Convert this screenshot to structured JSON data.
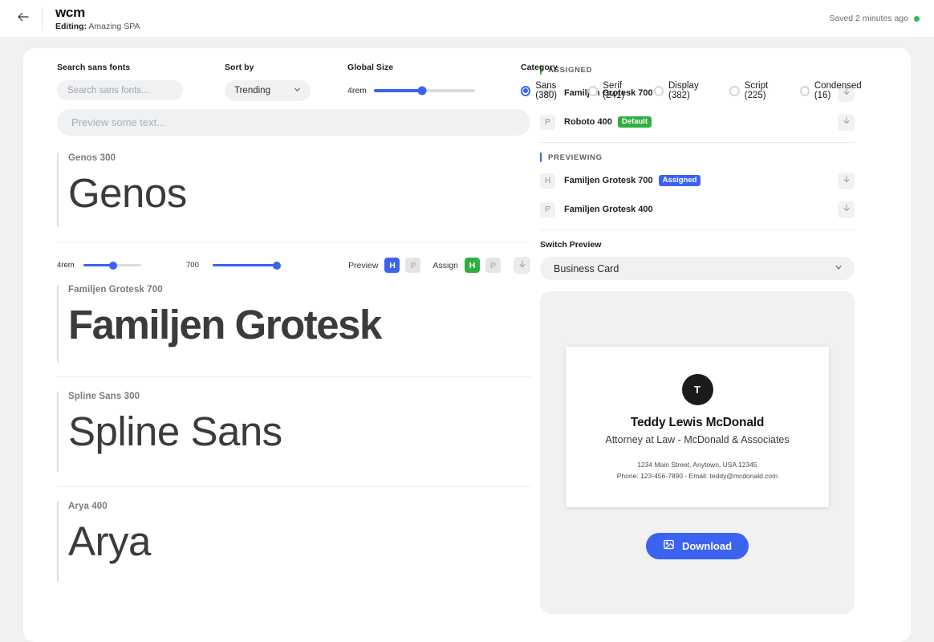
{
  "topbar": {
    "back_icon": "arrow-left-icon",
    "brand": "wcm",
    "editing_prefix": "Editing:",
    "editing_project": "Amazing SPA",
    "saved_status": "Saved 2 minutes ago",
    "saved_dot_color": "#2ebd4e"
  },
  "controls": {
    "search": {
      "label": "Search sans fonts",
      "placeholder": "Search sans fonts...",
      "value": ""
    },
    "sort": {
      "label": "Sort by",
      "value": "Trending",
      "chevron": "chevron-down-icon"
    },
    "size": {
      "label": "Global Size",
      "value": "4rem",
      "fill_percent": 48
    },
    "category": {
      "label": "Category",
      "options": [
        {
          "label": "Sans (380)",
          "selected": true
        },
        {
          "label": "Serif (241)",
          "selected": false
        },
        {
          "label": "Display (382)",
          "selected": false
        },
        {
          "label": "Script (225)",
          "selected": false
        },
        {
          "label": "Condensed (16)",
          "selected": false
        }
      ]
    }
  },
  "preview_text": {
    "placeholder": "Preview some text...",
    "value": ""
  },
  "fonts": [
    {
      "name": "Genos 300",
      "sample": "Genos"
    },
    {
      "name": "Familjen Grotesk 700",
      "sample": "Familjen Grotesk",
      "toolbar": {
        "size_value": "4rem",
        "size_fill_percent": 52,
        "weight_value": "700",
        "weight_fill_percent": 100,
        "preview_label": "Preview",
        "preview_h": "H",
        "preview_p": "P",
        "assign_label": "Assign",
        "assign_h": "H",
        "assign_p": "P",
        "download_icon": "download-arrow-icon"
      }
    },
    {
      "name": "Spline Sans 300",
      "sample": "Spline Sans"
    },
    {
      "name": "Arya 400",
      "sample": "Arya"
    }
  ],
  "assigned": {
    "title": "ASSIGNED",
    "accent_color": "#2eae42",
    "rows": [
      {
        "tag": "H",
        "name": "Familjen Grotesk 700",
        "badge": null,
        "download_icon": "download-arrow-icon"
      },
      {
        "tag": "P",
        "name": "Roboto 400",
        "badge": "Default",
        "badge_color": "#2eae42",
        "download_icon": "download-arrow-icon"
      }
    ]
  },
  "previewing": {
    "title": "PREVIEWING",
    "accent_color": "#3b63f0",
    "rows": [
      {
        "tag": "H",
        "name": "Familjen Grotesk 700",
        "badge": "Assigned",
        "badge_color": "#3b63f0",
        "download_icon": "download-arrow-icon"
      },
      {
        "tag": "P",
        "name": "Familjen Grotesk 400",
        "badge": null,
        "download_icon": "download-arrow-icon"
      }
    ]
  },
  "switch_preview": {
    "label": "Switch Preview",
    "value": "Business Card",
    "chevron": "chevron-down-icon"
  },
  "business_card": {
    "avatar_initial": "T",
    "name": "Teddy Lewis McDonald",
    "title": "Attorney at Law - McDonald & Associates",
    "address": "1234 Main Street, Anytown, USA 12345",
    "contact": "Phone: 123-456-7890 - Email: teddy@mcdonald.com"
  },
  "download_button": {
    "label": "Download",
    "icon": "image-icon",
    "color": "#3b63f0"
  }
}
